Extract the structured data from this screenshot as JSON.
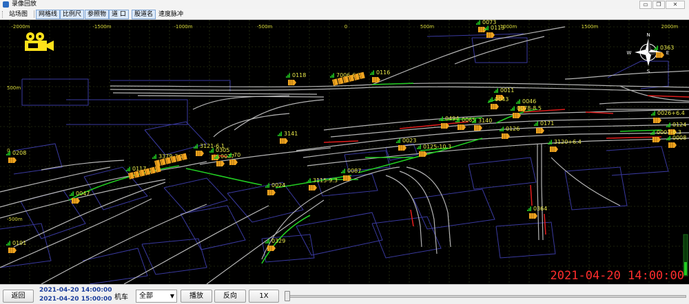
{
  "window": {
    "title": "录像回放",
    "subtitle_blurred": "",
    "buttons": {
      "minimize": "▭",
      "maximize": "❐",
      "close": "✕"
    }
  },
  "toolbar": {
    "items": [
      "站场图",
      "网格线",
      "比例尺",
      "参照物",
      "道 口",
      "股道名",
      "速度脉冲"
    ]
  },
  "map": {
    "scale_labels_top": [
      "-2000m",
      "-1500m",
      "-1000m",
      "-500m",
      "0",
      "500m",
      "1000m",
      "1500m",
      "2000m"
    ],
    "scale_labels_left": [
      "500m",
      "0",
      "-500m"
    ],
    "compass": {
      "north": "N",
      "south": "S",
      "west": "W",
      "east": "E"
    },
    "vehicles": [
      {
        "label": "0118"
      },
      {
        "label": "7006-6.3"
      },
      {
        "label": "0116"
      },
      {
        "label": "0073"
      },
      {
        "label": "0113"
      },
      {
        "label": "0363"
      },
      {
        "label": "0011"
      },
      {
        "label": "0043"
      },
      {
        "label": "0046"
      },
      {
        "label": "0078-8.5"
      },
      {
        "label": "0026+6.4"
      },
      {
        "label": "0494"
      },
      {
        "label": "0065"
      },
      {
        "label": "3140"
      },
      {
        "label": "0171"
      },
      {
        "label": "0126"
      },
      {
        "label": "0124"
      },
      {
        "label": "0007-6.3"
      },
      {
        "label": "0008"
      },
      {
        "label": "3141"
      },
      {
        "label": "0023"
      },
      {
        "label": "0125-10.3"
      },
      {
        "label": "3120+6.4"
      },
      {
        "label": "3121-6.1"
      },
      {
        "label": "0305"
      },
      {
        "label": "0077"
      },
      {
        "label": "70"
      },
      {
        "label": "3379-3.7"
      },
      {
        "label": "0208"
      },
      {
        "label": "0117"
      },
      {
        "label": "0087"
      },
      {
        "label": "3115-9.3"
      },
      {
        "label": "0024"
      },
      {
        "label": "0047"
      },
      {
        "label": "0364"
      },
      {
        "label": "0329"
      },
      {
        "label": "0191"
      }
    ],
    "timestamp": "2021-04-20  14:00:00"
  },
  "bottom": {
    "back_label": "返回",
    "start_time": "2021-04-20 14:00:00",
    "end_time": "2021-04-20 15:00:00",
    "loco_label": "机车",
    "loco_select": "全部",
    "play_label": "播放",
    "reverse_label": "反向",
    "speed_label": "1X"
  },
  "colors": {
    "map_bg": "#000000",
    "grid": "#3d4a18",
    "scale_text": "#d9d93a",
    "track_gray": "#b5b5b5",
    "track_green": "#22cc22",
    "track_red": "#dd1c1c",
    "building_outline": "#3a3aa0",
    "vehicle_label": "#e8e84a",
    "vehicle_body": "#f1a520",
    "timestamp_red": "#ff2d2d",
    "video_icon": "#ffe21a"
  }
}
